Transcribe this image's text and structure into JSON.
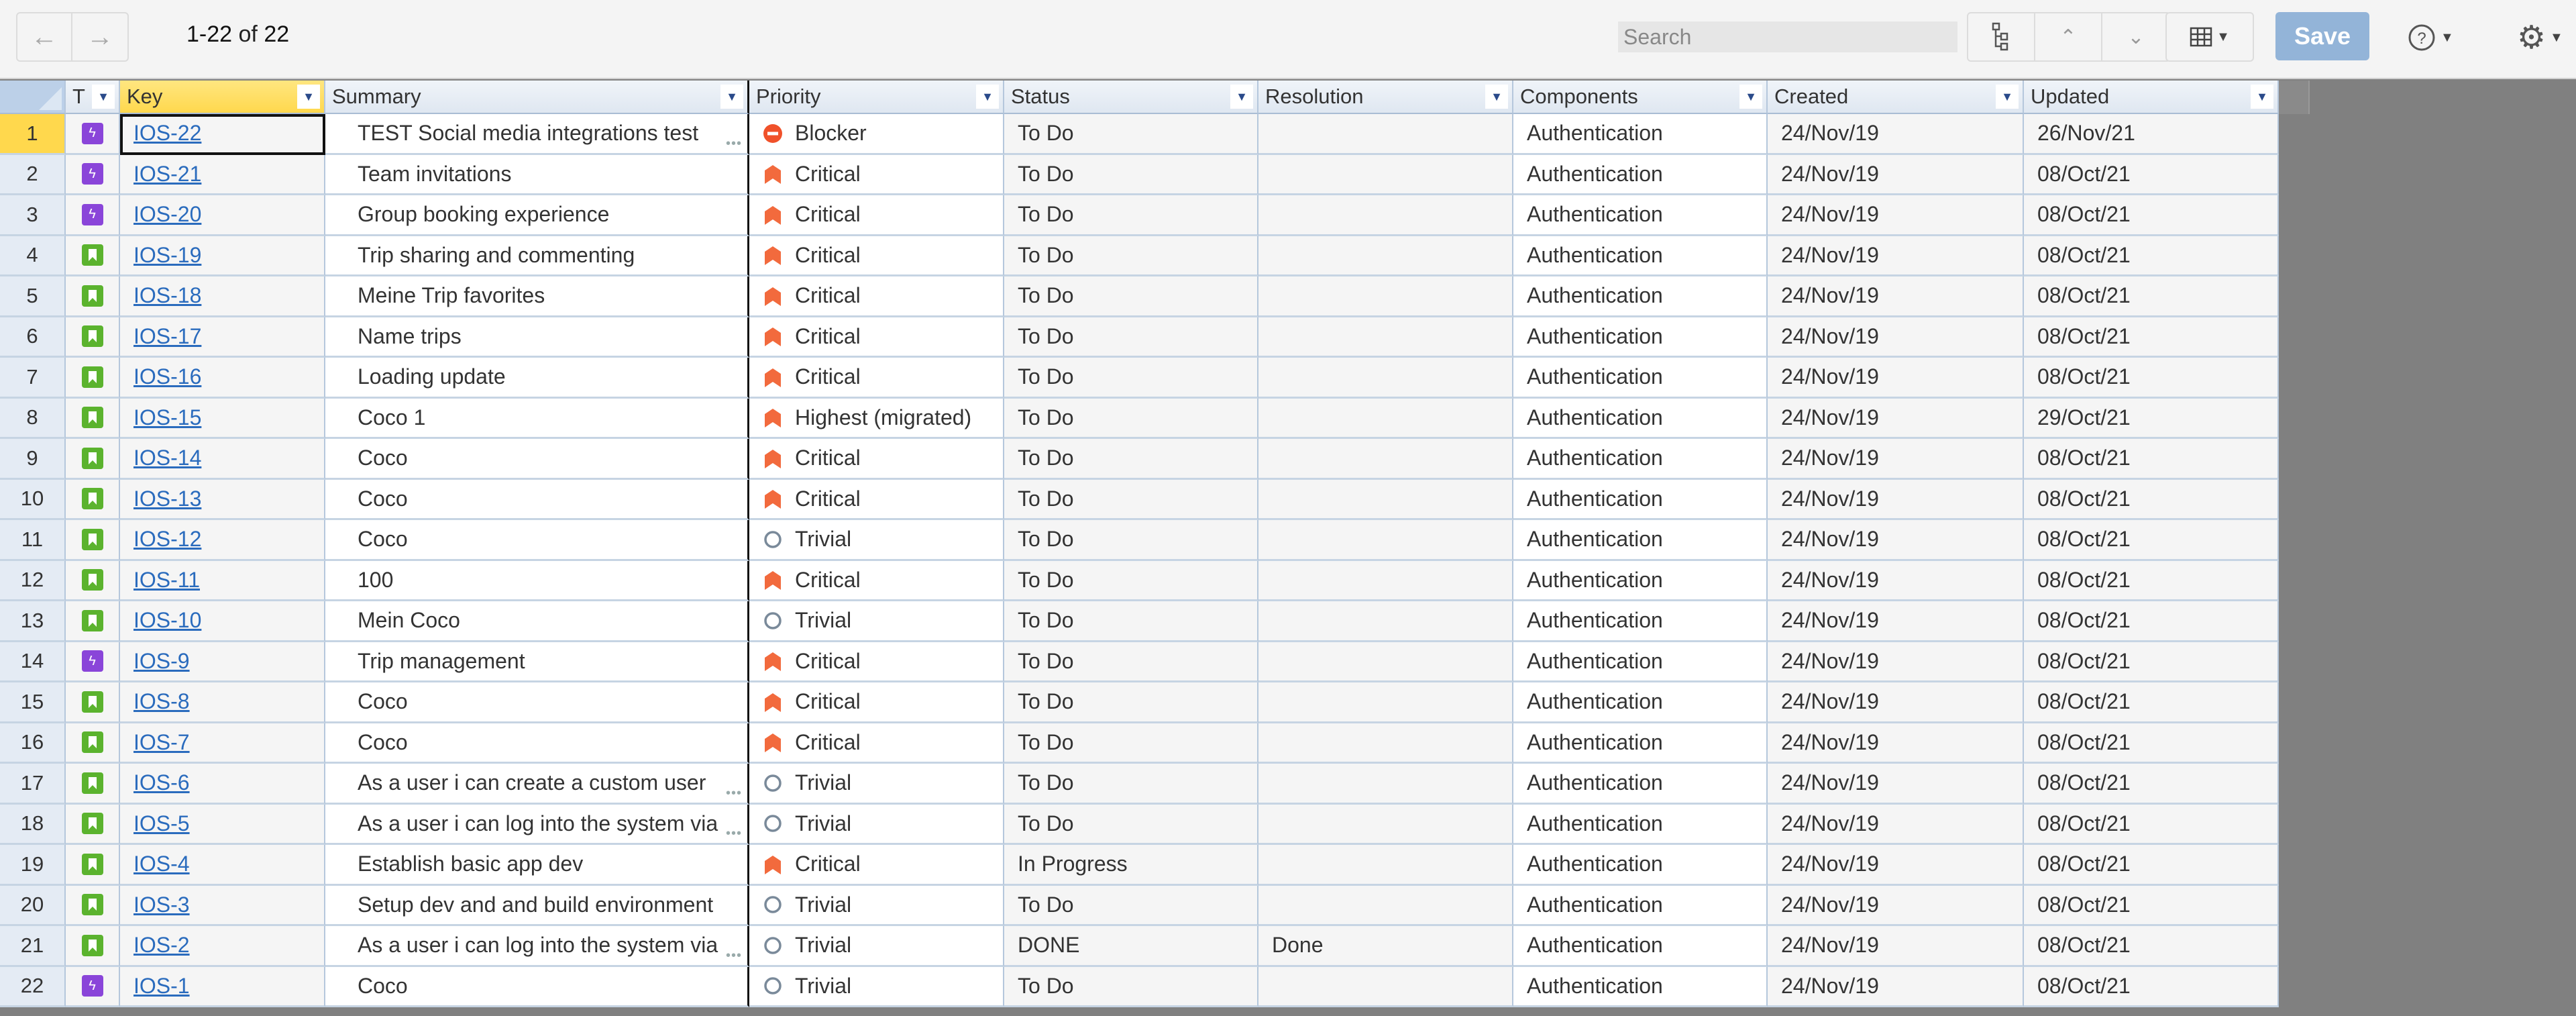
{
  "toolbar": {
    "back_label": "←",
    "forward_label": "→",
    "pager_range": "1-22",
    "pager_of": "of",
    "pager_total": "22",
    "search_placeholder": "Search",
    "hierarchy_icon": "hierarchy-icon",
    "collapse_icon": "collapse-all-icon",
    "expand_icon": "expand-all-icon",
    "columns_icon": "columns-icon",
    "save_label": "Save",
    "help_icon": "help-icon",
    "settings_icon": "gear-icon",
    "colors": {
      "save_bg": "#93b4d8",
      "active_header": "#ffd84d"
    }
  },
  "columns": [
    {
      "key": "type",
      "label": "T"
    },
    {
      "key": "key",
      "label": "Key"
    },
    {
      "key": "summary",
      "label": "Summary"
    },
    {
      "key": "priority",
      "label": "Priority"
    },
    {
      "key": "status",
      "label": "Status"
    },
    {
      "key": "resolution",
      "label": "Resolution"
    },
    {
      "key": "components",
      "label": "Components"
    },
    {
      "key": "created",
      "label": "Created"
    },
    {
      "key": "updated",
      "label": "Updated"
    }
  ],
  "priority_icons": {
    "Blocker": {
      "icon": "blocker-icon",
      "color": "#f0512a"
    },
    "Critical": {
      "icon": "critical-icon",
      "color": "#f26a3d"
    },
    "Highest (migrated)": {
      "icon": "highest-icon",
      "color": "#f26a3d"
    },
    "Trivial": {
      "icon": "trivial-icon",
      "color": "#7a8a9a"
    }
  },
  "type_icons": {
    "epic": {
      "icon": "epic-icon",
      "color": "#8a45d9"
    },
    "story": {
      "icon": "story-icon",
      "color": "#5bb32e"
    }
  },
  "rows": [
    {
      "num": "1",
      "type": "epic",
      "key": "IOS-22",
      "summary": "TEST Social media integrations test",
      "truncated": true,
      "priority": "Blocker",
      "status": "To Do",
      "resolution": "",
      "components": "Authentication",
      "created": "24/Nov/19",
      "updated": "26/Nov/21"
    },
    {
      "num": "2",
      "type": "epic",
      "key": "IOS-21",
      "summary": "Team invitations",
      "truncated": false,
      "priority": "Critical",
      "status": "To Do",
      "resolution": "",
      "components": "Authentication",
      "created": "24/Nov/19",
      "updated": "08/Oct/21"
    },
    {
      "num": "3",
      "type": "epic",
      "key": "IOS-20",
      "summary": "Group booking experience",
      "truncated": false,
      "priority": "Critical",
      "status": "To Do",
      "resolution": "",
      "components": "Authentication",
      "created": "24/Nov/19",
      "updated": "08/Oct/21"
    },
    {
      "num": "4",
      "type": "story",
      "key": "IOS-19",
      "summary": "Trip sharing and commenting",
      "truncated": false,
      "priority": "Critical",
      "status": "To Do",
      "resolution": "",
      "components": "Authentication",
      "created": "24/Nov/19",
      "updated": "08/Oct/21"
    },
    {
      "num": "5",
      "type": "story",
      "key": "IOS-18",
      "summary": "Meine Trip favorites",
      "truncated": false,
      "priority": "Critical",
      "status": "To Do",
      "resolution": "",
      "components": "Authentication",
      "created": "24/Nov/19",
      "updated": "08/Oct/21"
    },
    {
      "num": "6",
      "type": "story",
      "key": "IOS-17",
      "summary": "Name trips",
      "truncated": false,
      "priority": "Critical",
      "status": "To Do",
      "resolution": "",
      "components": "Authentication",
      "created": "24/Nov/19",
      "updated": "08/Oct/21"
    },
    {
      "num": "7",
      "type": "story",
      "key": "IOS-16",
      "summary": "Loading update",
      "truncated": false,
      "priority": "Critical",
      "status": "To Do",
      "resolution": "",
      "components": "Authentication",
      "created": "24/Nov/19",
      "updated": "08/Oct/21"
    },
    {
      "num": "8",
      "type": "story",
      "key": "IOS-15",
      "summary": "Coco 1",
      "truncated": false,
      "priority": "Highest (migrated)",
      "status": "To Do",
      "resolution": "",
      "components": "Authentication",
      "created": "24/Nov/19",
      "updated": "29/Oct/21"
    },
    {
      "num": "9",
      "type": "story",
      "key": "IOS-14",
      "summary": "Coco",
      "truncated": false,
      "priority": "Critical",
      "status": "To Do",
      "resolution": "",
      "components": "Authentication",
      "created": "24/Nov/19",
      "updated": "08/Oct/21"
    },
    {
      "num": "10",
      "type": "story",
      "key": "IOS-13",
      "summary": "Coco",
      "truncated": false,
      "priority": "Critical",
      "status": "To Do",
      "resolution": "",
      "components": "Authentication",
      "created": "24/Nov/19",
      "updated": "08/Oct/21"
    },
    {
      "num": "11",
      "type": "story",
      "key": "IOS-12",
      "summary": "Coco",
      "truncated": false,
      "priority": "Trivial",
      "status": "To Do",
      "resolution": "",
      "components": "Authentication",
      "created": "24/Nov/19",
      "updated": "08/Oct/21"
    },
    {
      "num": "12",
      "type": "story",
      "key": "IOS-11",
      "summary": "100",
      "truncated": false,
      "priority": "Critical",
      "status": "To Do",
      "resolution": "",
      "components": "Authentication",
      "created": "24/Nov/19",
      "updated": "08/Oct/21"
    },
    {
      "num": "13",
      "type": "story",
      "key": "IOS-10",
      "summary": "Mein Coco",
      "truncated": false,
      "priority": "Trivial",
      "status": "To Do",
      "resolution": "",
      "components": "Authentication",
      "created": "24/Nov/19",
      "updated": "08/Oct/21"
    },
    {
      "num": "14",
      "type": "epic",
      "key": "IOS-9",
      "summary": "Trip management",
      "truncated": false,
      "priority": "Critical",
      "status": "To Do",
      "resolution": "",
      "components": "Authentication",
      "created": "24/Nov/19",
      "updated": "08/Oct/21"
    },
    {
      "num": "15",
      "type": "story",
      "key": "IOS-8",
      "summary": "Coco",
      "truncated": false,
      "priority": "Critical",
      "status": "To Do",
      "resolution": "",
      "components": "Authentication",
      "created": "24/Nov/19",
      "updated": "08/Oct/21"
    },
    {
      "num": "16",
      "type": "story",
      "key": "IOS-7",
      "summary": "Coco",
      "truncated": false,
      "priority": "Critical",
      "status": "To Do",
      "resolution": "",
      "components": "Authentication",
      "created": "24/Nov/19",
      "updated": "08/Oct/21"
    },
    {
      "num": "17",
      "type": "story",
      "key": "IOS-6",
      "summary": "As a user i can create a custom user",
      "truncated": true,
      "priority": "Trivial",
      "status": "To Do",
      "resolution": "",
      "components": "Authentication",
      "created": "24/Nov/19",
      "updated": "08/Oct/21"
    },
    {
      "num": "18",
      "type": "story",
      "key": "IOS-5",
      "summary": "As a user i can log into the system via",
      "truncated": true,
      "priority": "Trivial",
      "status": "To Do",
      "resolution": "",
      "components": "Authentication",
      "created": "24/Nov/19",
      "updated": "08/Oct/21"
    },
    {
      "num": "19",
      "type": "story",
      "key": "IOS-4",
      "summary": "Establish basic app dev",
      "truncated": false,
      "priority": "Critical",
      "status": "In Progress",
      "resolution": "",
      "components": "Authentication",
      "created": "24/Nov/19",
      "updated": "08/Oct/21"
    },
    {
      "num": "20",
      "type": "story",
      "key": "IOS-3",
      "summary": "Setup dev and and build environment",
      "truncated": false,
      "priority": "Trivial",
      "status": "To Do",
      "resolution": "",
      "components": "Authentication",
      "created": "24/Nov/19",
      "updated": "08/Oct/21"
    },
    {
      "num": "21",
      "type": "story",
      "key": "IOS-2",
      "summary": "As a user i can log into the system via",
      "truncated": true,
      "priority": "Trivial",
      "status": "DONE",
      "resolution": "Done",
      "components": "Authentication",
      "created": "24/Nov/19",
      "updated": "08/Oct/21"
    },
    {
      "num": "22",
      "type": "epic",
      "key": "IOS-1",
      "summary": "Coco",
      "truncated": false,
      "priority": "Trivial",
      "status": "To Do",
      "resolution": "",
      "components": "Authentication",
      "created": "24/Nov/19",
      "updated": "08/Oct/21"
    }
  ]
}
